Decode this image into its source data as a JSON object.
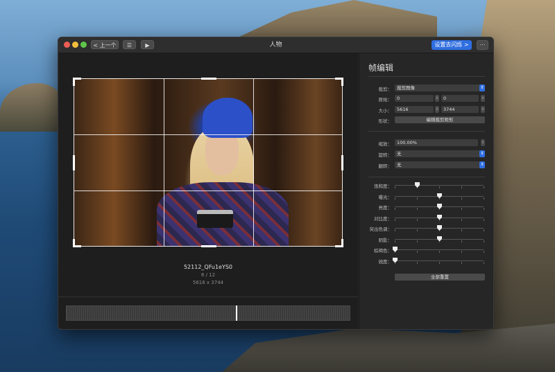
{
  "window": {
    "title": "人物"
  },
  "toolbar": {
    "prev_label": "< 上一个",
    "list_icon": "list-icon",
    "play_icon": "play-icon",
    "set_flash_label": "设置去闪烁 >",
    "more_icon": "ellipsis-icon"
  },
  "photo": {
    "name": "52112_QFu1eYS0",
    "index": "8 / 12",
    "dimensions": "5616 x 3744"
  },
  "timeline": {
    "position_fraction": 0.6
  },
  "panel": {
    "title": "帧编辑",
    "crop": {
      "label": "裁剪：",
      "value": "裁剪图像"
    },
    "origin": {
      "label": "原始：",
      "x": "0",
      "y": "0"
    },
    "size": {
      "label": "大小：",
      "w": "5616",
      "h": "3744"
    },
    "shape": {
      "label": "形状：",
      "button": "编辑裁剪矩形"
    },
    "scale": {
      "label": "缩放：",
      "value": "100.00%"
    },
    "rotate": {
      "label": "旋转：",
      "value": "无"
    },
    "flip": {
      "label": "翻转：",
      "value": "无"
    },
    "adjustments": [
      {
        "label": "饱和度：",
        "value": 0.25
      },
      {
        "label": "曝光：",
        "value": 0.5
      },
      {
        "label": "亮度：",
        "value": 0.5
      },
      {
        "label": "对比度：",
        "value": 0.5
      },
      {
        "label": "突出色调：",
        "value": 0.5
      },
      {
        "label": "阴影：",
        "value": 0.5
      },
      {
        "label": "棕褐色：",
        "value": 0.0
      },
      {
        "label": "锐度：",
        "value": 0.0
      }
    ],
    "reset_label": "全部重置"
  }
}
